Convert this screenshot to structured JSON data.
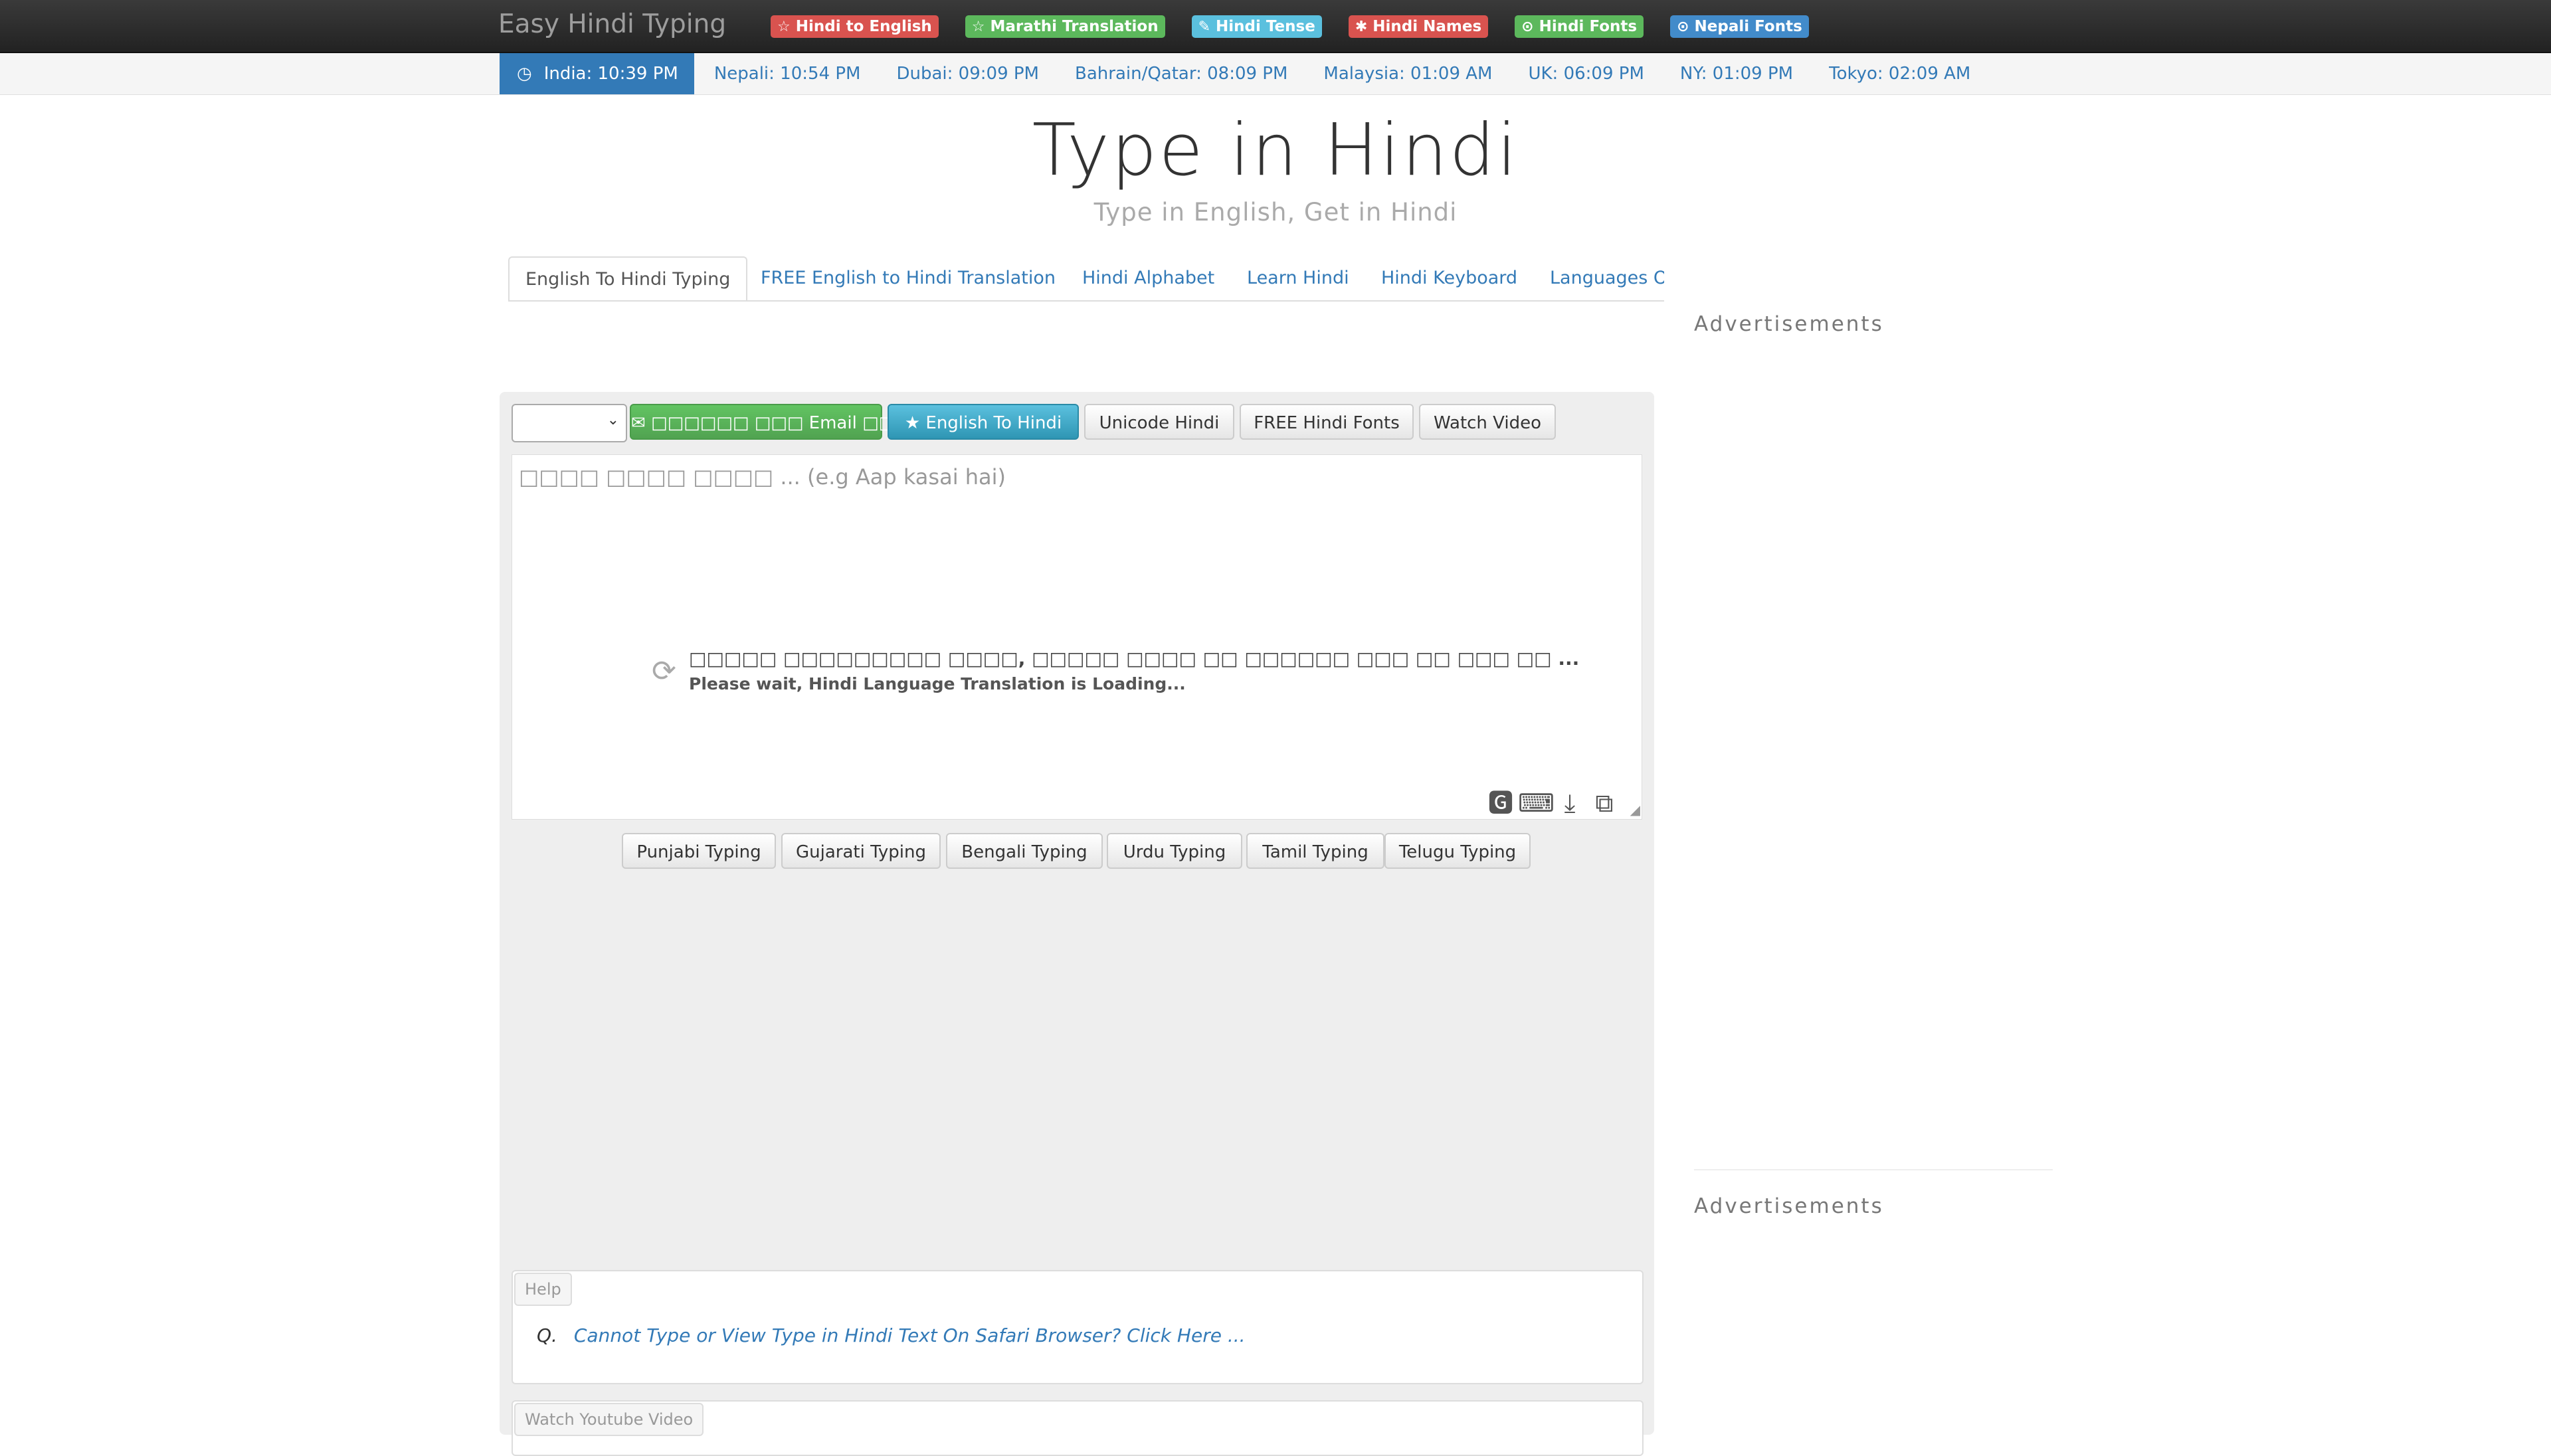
{
  "brand": "Easy Hindi Typing",
  "top_nav": [
    {
      "label": "Hindi to English",
      "icon": "star-icon",
      "color": "#d9534f"
    },
    {
      "label": "Marathi Translation",
      "icon": "star-icon",
      "color": "#5cb85c"
    },
    {
      "label": "Hindi Tense",
      "icon": "pencil-icon",
      "color": "#5bc0de"
    },
    {
      "label": "Hindi Names",
      "icon": "asterisk-icon",
      "color": "#d9534f"
    },
    {
      "label": "Hindi Fonts",
      "icon": "circle-arrow-icon",
      "color": "#5cb85c"
    },
    {
      "label": "Nepali Fonts",
      "icon": "circle-arrow-icon",
      "color": "#428bca"
    }
  ],
  "times": [
    "India: 10:39 PM",
    "Nepali: 10:54 PM",
    "Dubai: 09:09 PM",
    "Bahrain/Qatar: 08:09 PM",
    "Malaysia: 01:09 AM",
    "UK: 06:09 PM",
    "NY: 01:09 PM",
    "Tokyo: 02:09 AM"
  ],
  "hero": {
    "title": "Type in Hindi",
    "subtitle": "Type in English, Get in Hindi"
  },
  "tabs": [
    "English To Hindi Typing",
    "FREE English to Hindi Translation",
    "Hindi Alphabet",
    "Learn Hindi",
    "Hindi Keyboard",
    "Languages O"
  ],
  "ads": {
    "heading_1": "Advertisements",
    "heading_2": "Advertisements"
  },
  "toolbar": {
    "select_value": "",
    "email_button": "✉ □□□□□□ □□□ Email □□□□",
    "english_to_hindi_button": "★ English To Hindi",
    "unicode_button": "Unicode Hindi",
    "fonts_button": "FREE Hindi Fonts",
    "video_button": "Watch Video"
  },
  "editor": {
    "placeholder": "□□□□ □□□□ □□□□ ... (e.g Aap kasai hai)",
    "loading_hindi": "□□□□□ □□□□□□□□□ □□□□, □□□□□ □□□□ □□ □□□□□□ □□□ □□ □□□ □□ ...",
    "loading_english": "Please wait, Hindi Language Translation is Loading...",
    "icons": [
      "google-translate-icon",
      "keyboard-icon",
      "download-icon",
      "copy-icon"
    ]
  },
  "languages": [
    "Punjabi Typing",
    "Gujarati Typing",
    "Bengali Typing",
    "Urdu Typing",
    "Tamil Typing",
    "Telugu Typing"
  ],
  "help": {
    "label": "Help",
    "q_prefix": "Q.",
    "question": "Cannot Type or View Type in Hindi Text On Safari Browser? Click Here ..."
  },
  "youtube": {
    "label": "Watch Youtube Video"
  }
}
